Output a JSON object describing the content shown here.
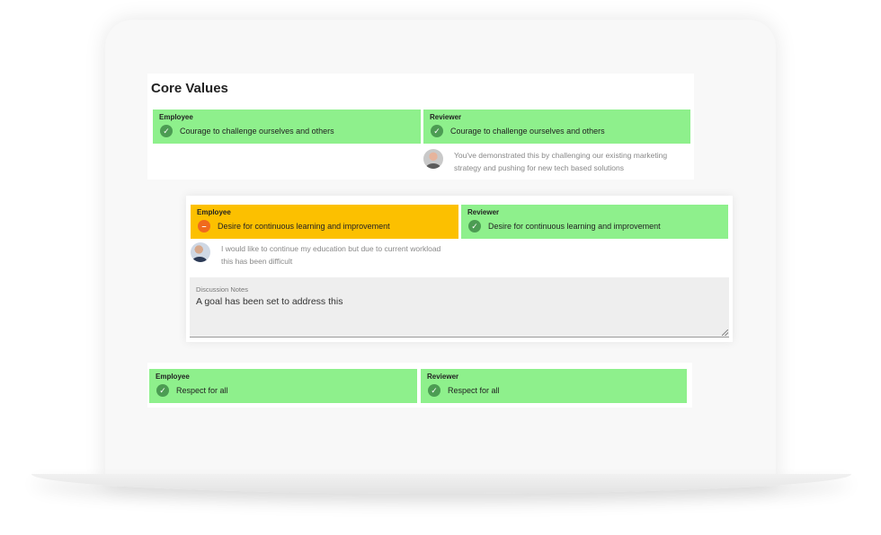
{
  "section": {
    "title": "Core Values"
  },
  "values": [
    {
      "employee": {
        "label": "Employee",
        "text": "Courage to challenge ourselves and others",
        "status": "met",
        "status_color": "#8ef08c"
      },
      "reviewer": {
        "label": "Reviewer",
        "text": "Courage to challenge ourselves and others",
        "status": "met",
        "status_color": "#8ef08c"
      },
      "comment": {
        "author_role": "reviewer",
        "text": "You've demonstrated this by challenging our existing marketing strategy and pushing for new tech based solutions"
      }
    },
    {
      "employee": {
        "label": "Employee",
        "text": "Desire for continuous learning and improvement",
        "status": "partial",
        "status_color": "#fcc000"
      },
      "reviewer": {
        "label": "Reviewer",
        "text": "Desire for continuous learning and improvement",
        "status": "met",
        "status_color": "#8ef08c"
      },
      "comment": {
        "author_role": "employee",
        "text": "I would like to continue my education but due to current workload this has been difficult"
      },
      "discussion_notes": {
        "label": "Discussion Notes",
        "value": "A goal has been set to address this"
      }
    },
    {
      "employee": {
        "label": "Employee",
        "text": "Respect for all",
        "status": "met",
        "status_color": "#8ef08c"
      },
      "reviewer": {
        "label": "Reviewer",
        "text": "Respect for all",
        "status": "met",
        "status_color": "#8ef08c"
      }
    }
  ],
  "icons": {
    "met": "check-circle-icon",
    "partial": "minus-circle-icon"
  }
}
